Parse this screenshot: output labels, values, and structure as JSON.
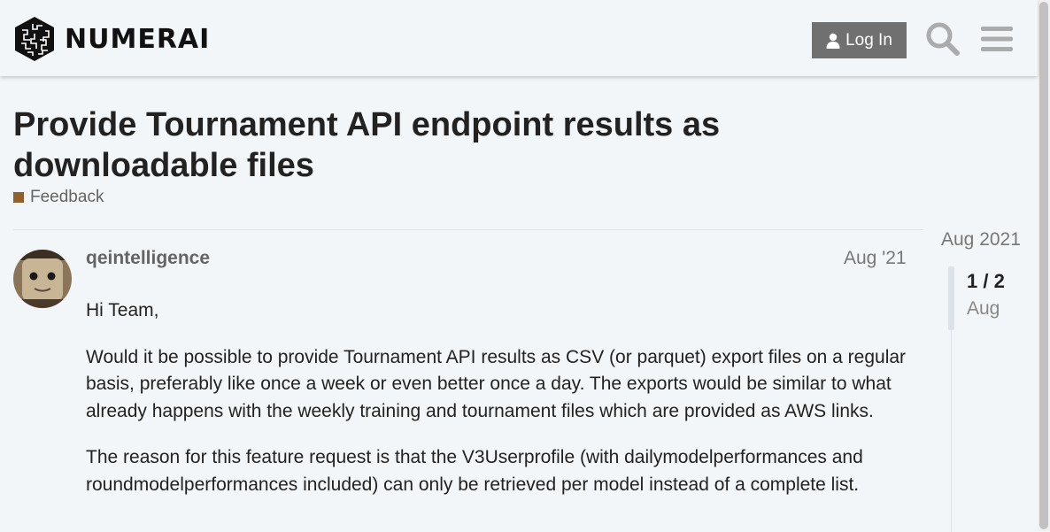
{
  "header": {
    "logo_text": "NUMERAI",
    "login_label": "Log In",
    "icons": [
      "user-icon",
      "search-icon",
      "hamburger-menu-icon"
    ]
  },
  "topic": {
    "title": "Provide Tournament API endpoint results as downloadable files",
    "category": "Feedback",
    "category_color": "#92602a"
  },
  "post": {
    "username": "qeintelligence",
    "date": "Aug '21",
    "paragraphs": [
      "Hi Team,",
      "Would it be possible to provide Tournament API results as CSV (or parquet) export files on a regular basis, preferably like once a week or even better once a day. The exports would be similar to what already happens with the weekly training and tournament files which are provided as AWS links.",
      "The reason for this feature request is that the V3Userprofile (with dailymodelperformances and roundmodelperformances included) can only be retrieved per model instead of a complete list."
    ]
  },
  "timeline": {
    "start_date": "Aug 2021",
    "position": "1 / 2",
    "current_date": "Aug"
  },
  "colors": {
    "background": "#f3f6f8",
    "login_button": "#707070",
    "text_primary": "#222222",
    "text_muted": "#646464"
  }
}
